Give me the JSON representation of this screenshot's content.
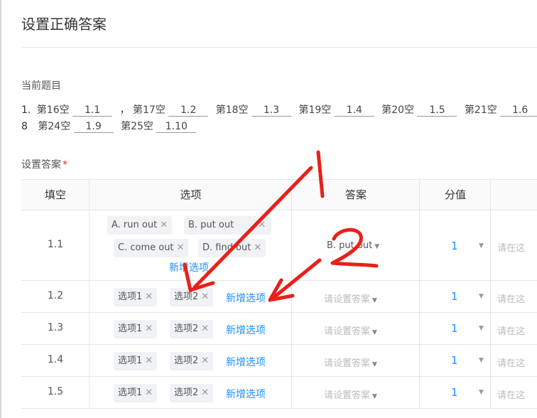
{
  "page": {
    "title": "设置正确答案"
  },
  "question_section": {
    "label": "当前题目",
    "number": "1.",
    "line1": [
      {
        "label": "第16空",
        "value": "1.1",
        "sep": "，"
      },
      {
        "label": "第17空",
        "value": "1.2"
      },
      {
        "label": "第18空",
        "value": "1.3"
      },
      {
        "label": "第19空",
        "value": "1.4"
      },
      {
        "label": "第20空",
        "value": "1.5"
      },
      {
        "label": "第21空",
        "value": "1.6"
      }
    ],
    "line2_lead": "8",
    "line2": [
      {
        "label": "第24空",
        "value": "1.9"
      },
      {
        "label": "第25空",
        "value": "1.10"
      }
    ]
  },
  "answer_section": {
    "label": "设置答案",
    "required_mark": "*"
  },
  "table": {
    "headers": [
      "填空",
      "选项",
      "答案",
      "分值"
    ],
    "new_option_label": "新增选项",
    "remark_placeholder": "请在这",
    "rows": [
      {
        "blank": "1.1",
        "options": [
          "A. run out",
          "B. put out",
          "C. come out",
          "D. find out"
        ],
        "answer": "B. put out",
        "score": "1"
      },
      {
        "blank": "1.2",
        "options": [
          "选项1",
          "选项2"
        ],
        "answer": "请设置答案",
        "score": "1"
      },
      {
        "blank": "1.3",
        "options": [
          "选项1",
          "选项2"
        ],
        "answer": "请设置答案",
        "score": "1"
      },
      {
        "blank": "1.4",
        "options": [
          "选项1",
          "选项2"
        ],
        "answer": "请设置答案",
        "score": "1"
      },
      {
        "blank": "1.5",
        "options": [
          "选项1",
          "选项2"
        ],
        "answer": "请设置答案",
        "score": "1"
      }
    ]
  },
  "annotations": {
    "label_1": "1",
    "label_2": "2",
    "color": "#e8201a"
  },
  "icons": {
    "remove": "close-icon",
    "dropdown": "caret-down-icon"
  }
}
